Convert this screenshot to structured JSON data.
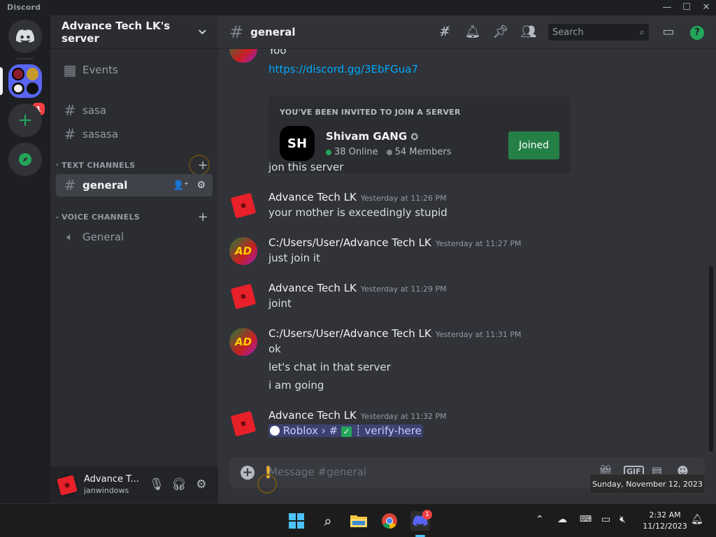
{
  "window": {
    "title": "Discord",
    "min": "—",
    "max": "☐",
    "close": "✕"
  },
  "rail": {
    "badge": "1"
  },
  "server": {
    "name": "Advance Tech LK's server"
  },
  "sidebar": {
    "events": "Events",
    "channels_top": [
      {
        "name": "sasa"
      },
      {
        "name": "sasasa"
      }
    ],
    "text_category": "TEXT CHANNELS",
    "text_channels": [
      {
        "name": "general"
      }
    ],
    "voice_category": "VOICE CHANNELS",
    "voice_channels": [
      {
        "name": "General"
      }
    ]
  },
  "user": {
    "name": "Advance T...",
    "status": "janwindows"
  },
  "chat": {
    "channel": "general",
    "search_placeholder": "Search",
    "composer_placeholder": "Message #general",
    "messages": [
      {
        "text": "Yoo"
      },
      {
        "link": "https://discord.gg/3EbFGua7"
      },
      {
        "text": "jon this server"
      },
      {
        "author": "Advance Tech LK",
        "time": "Yesterday at 11:26 PM",
        "text": "your mother is exceedingly stupid"
      },
      {
        "author": "C:/Users/User/Advance Tech LK",
        "time": "Yesterday at 11:27 PM",
        "text": "just join it"
      },
      {
        "author": "Advance Tech LK",
        "time": "Yesterday at 11:29 PM",
        "text": "joint"
      },
      {
        "author": "C:/Users/User/Advance Tech LK",
        "time": "Yesterday at 11:31 PM",
        "lines": [
          "ok",
          "let's chat in that server",
          "i am going"
        ]
      },
      {
        "author": "Advance Tech LK",
        "time": "Yesterday at 11:32 PM",
        "mention": {
          "server": "Roblox",
          "sep": "›",
          "channel": "┊ verify-here"
        }
      }
    ],
    "invite": {
      "label": "YOU'VE BEEN INVITED TO JOIN A SERVER",
      "server_name": "Shivam GANG",
      "icon_text": "SH",
      "online": "38 Online",
      "members": "54 Members",
      "button": "Joined"
    },
    "avatar_text": "AD"
  },
  "tooltip": "Sunday, November 12, 2023",
  "taskbar": {
    "time": "2:32 AM",
    "date": "11/12/2023",
    "discord_badge": "1"
  },
  "colors": {
    "accent": "#5865f2",
    "green": "#23a55a",
    "link": "#00a8fc"
  }
}
